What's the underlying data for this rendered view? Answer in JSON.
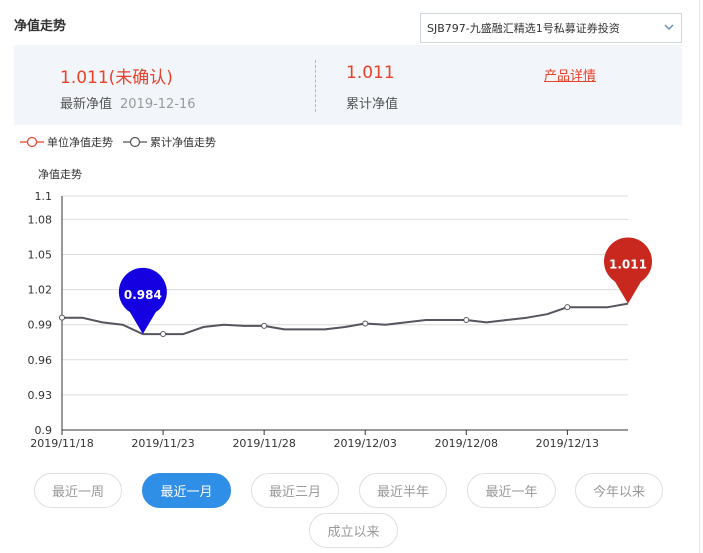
{
  "header": {
    "title": "净值走势"
  },
  "fund_select": {
    "selected": "SJB797-九盛融汇精选1号私募证券投资"
  },
  "summary": {
    "latest_nav_value": "1.011(未确认)",
    "latest_nav_label": "最新净值",
    "latest_nav_date": "2019-12-16",
    "cumulative_nav_value": "1.011",
    "cumulative_nav_label": "累计净值",
    "detail_link": "产品详情"
  },
  "legend": {
    "unit": "单位净值走势",
    "cumulative": "累计净值走势",
    "unit_color": "#e8422b",
    "cumulative_color": "#555555"
  },
  "chart_data": {
    "type": "line",
    "ylabel": "净值走势",
    "ylim": [
      0.9,
      1.1
    ],
    "ytick_labels": [
      "0.9",
      "0.93",
      "0.96",
      "0.99",
      "1.02",
      "1.05",
      "1.08",
      "1.1"
    ],
    "ytick_values": [
      0.9,
      0.93,
      0.96,
      0.99,
      1.02,
      1.05,
      1.08,
      1.1
    ],
    "xtick_labels": [
      "2019/11/18",
      "2019/11/23",
      "2019/11/28",
      "2019/12/03",
      "2019/12/08",
      "2019/12/13"
    ],
    "xtick_dates": [
      "2019-11-18",
      "2019-11-23",
      "2019-11-28",
      "2019-12-03",
      "2019-12-08",
      "2019-12-13"
    ],
    "grid": true,
    "series": [
      {
        "points": [
          [
            "2019-11-18",
            0.996
          ],
          [
            "2019-11-19",
            0.996
          ],
          [
            "2019-11-20",
            0.992
          ],
          [
            "2019-11-21",
            0.99
          ],
          [
            "2019-11-22",
            0.982
          ],
          [
            "2019-11-23",
            0.982
          ],
          [
            "2019-11-24",
            0.982
          ],
          [
            "2019-11-25",
            0.988
          ],
          [
            "2019-11-26",
            0.99
          ],
          [
            "2019-11-27",
            0.989
          ],
          [
            "2019-11-28",
            0.989
          ],
          [
            "2019-11-29",
            0.986
          ],
          [
            "2019-11-30",
            0.986
          ],
          [
            "2019-12-01",
            0.986
          ],
          [
            "2019-12-02",
            0.988
          ],
          [
            "2019-12-03",
            0.991
          ],
          [
            "2019-12-04",
            0.99
          ],
          [
            "2019-12-05",
            0.992
          ],
          [
            "2019-12-06",
            0.994
          ],
          [
            "2019-12-07",
            0.994
          ],
          [
            "2019-12-08",
            0.994
          ],
          [
            "2019-12-09",
            0.992
          ],
          [
            "2019-12-10",
            0.994
          ],
          [
            "2019-12-11",
            0.996
          ],
          [
            "2019-12-12",
            0.999
          ],
          [
            "2019-12-13",
            1.005
          ],
          [
            "2019-12-14",
            1.005
          ],
          [
            "2019-12-15",
            1.005
          ],
          [
            "2019-12-16",
            1.008
          ]
        ],
        "marker_dates": [
          "2019-11-18",
          "2019-11-23",
          "2019-11-28",
          "2019-12-03",
          "2019-12-08",
          "2019-12-13"
        ]
      }
    ],
    "annotations": [
      {
        "label": "0.984",
        "date": "2019-11-22",
        "value": 0.982,
        "kind": "min",
        "color": "#1400e0"
      },
      {
        "label": "1.011",
        "date": "2019-12-16",
        "value": 1.008,
        "kind": "max",
        "color": "#c8281e"
      }
    ]
  },
  "ranges": {
    "items": [
      "最近一周",
      "最近一月",
      "最近三月",
      "最近半年",
      "最近一年",
      "今年以来",
      "成立以来"
    ],
    "active": 1
  }
}
